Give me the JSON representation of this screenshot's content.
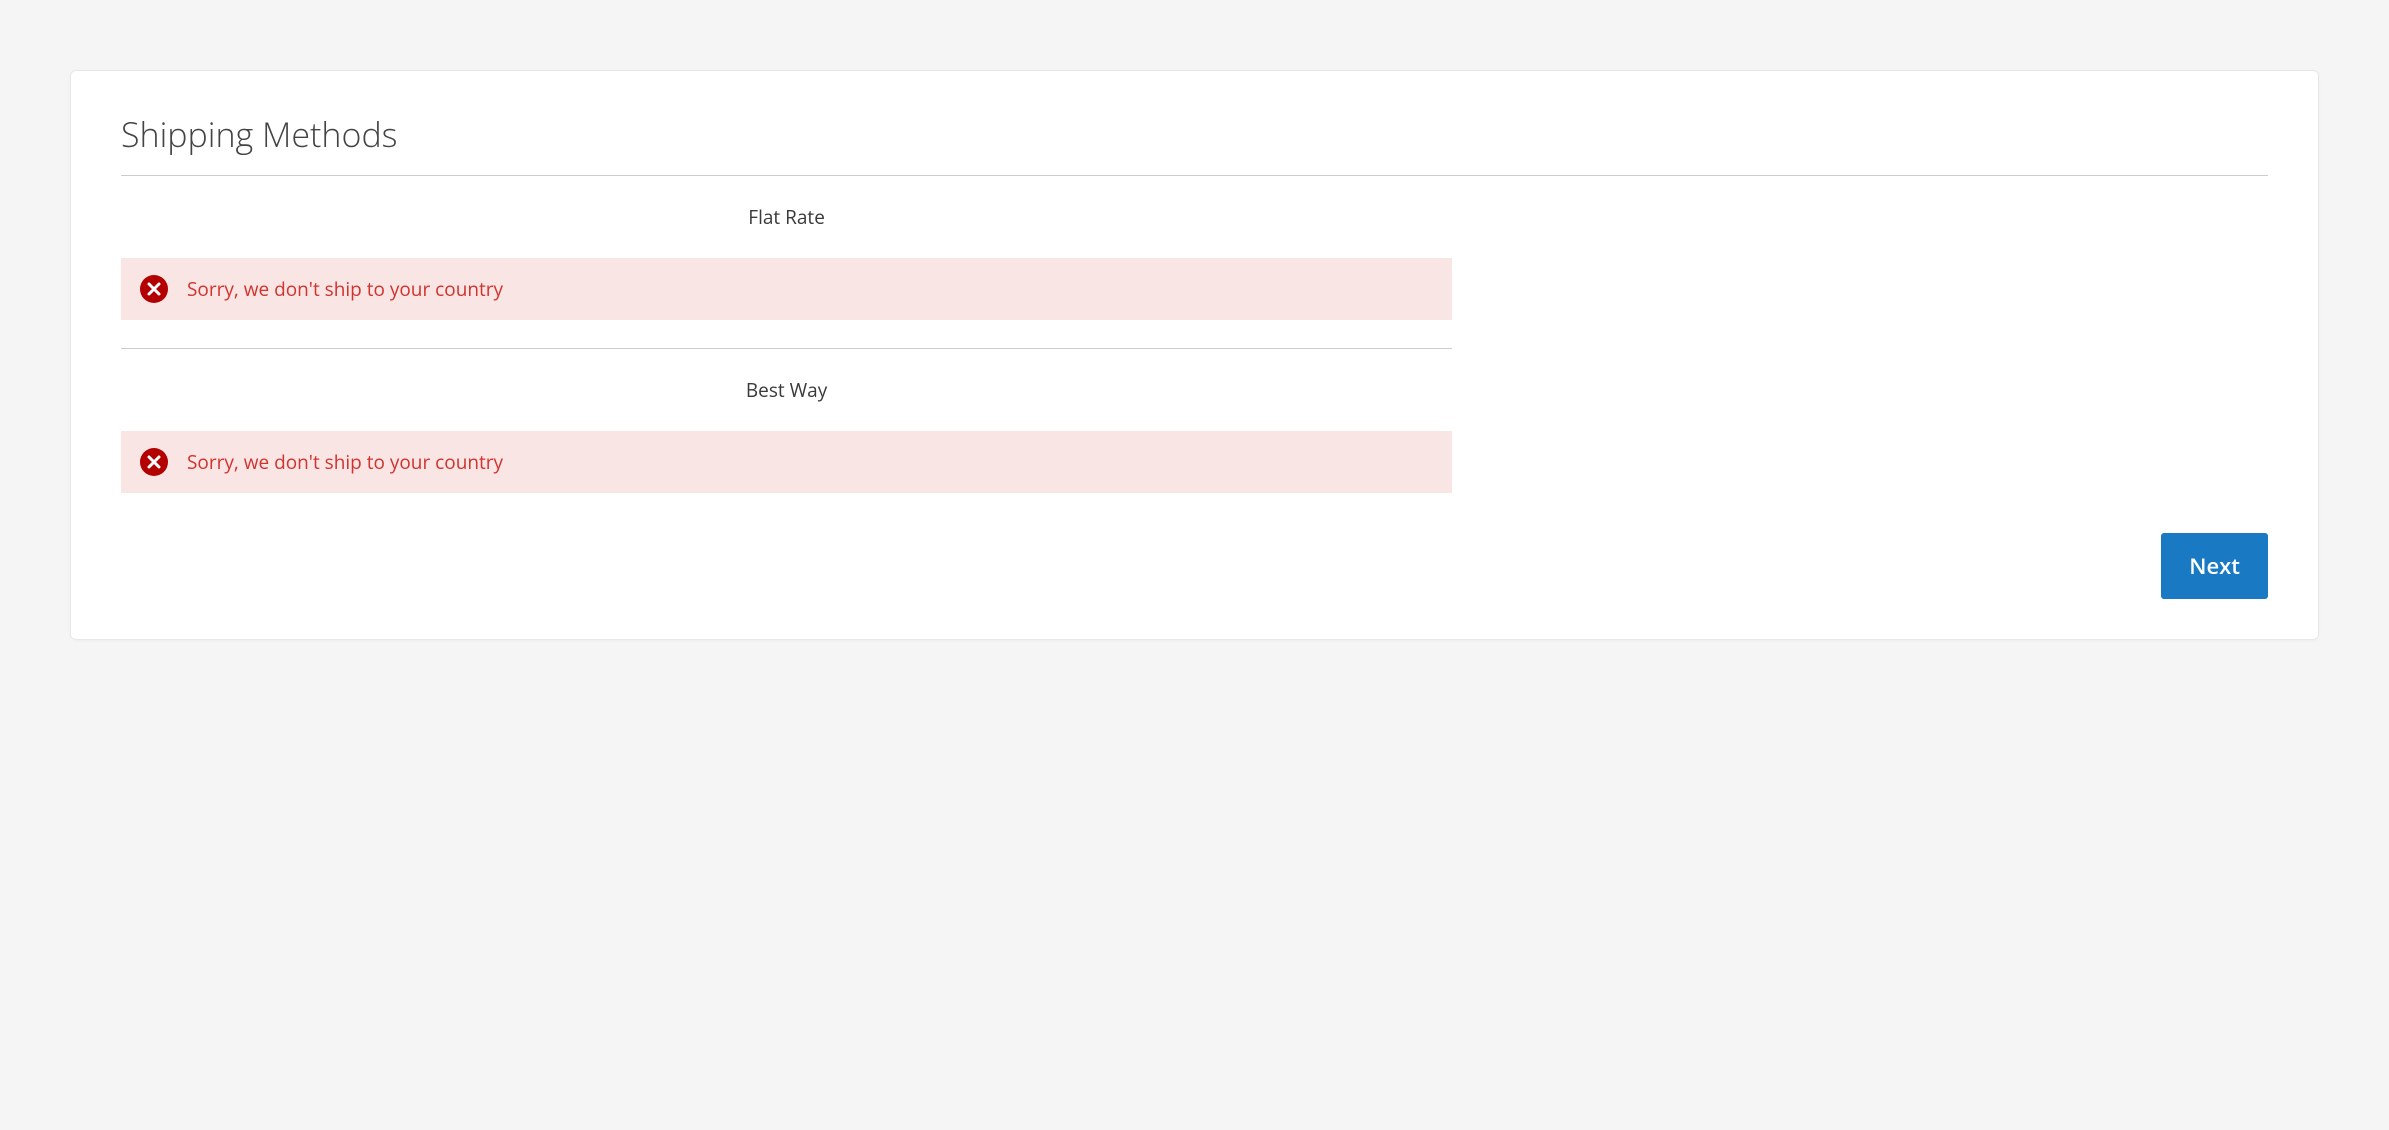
{
  "section": {
    "title": "Shipping Methods"
  },
  "methods": [
    {
      "label": "Flat Rate",
      "error": "Sorry, we don't ship to your country"
    },
    {
      "label": "Best Way",
      "error": "Sorry, we don't ship to your country"
    }
  ],
  "actions": {
    "next_label": "Next"
  }
}
